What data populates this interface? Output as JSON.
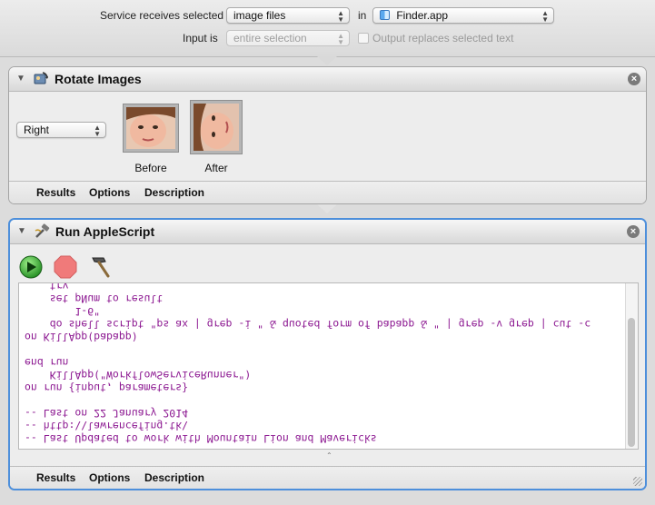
{
  "service": {
    "receives_label": "Service receives selected",
    "receives_value": "image files",
    "in_label": "in",
    "app_value": "Finder.app",
    "input_label": "Input is",
    "input_value": "entire selection",
    "output_label": "Output replaces selected text"
  },
  "rotate_action": {
    "title": "Rotate Images",
    "direction_value": "Right",
    "before_label": "Before",
    "after_label": "After",
    "tabs": [
      "Results",
      "Options",
      "Description"
    ]
  },
  "applescript_action": {
    "title": "Run AppleScript",
    "code_lines": [
      "-- Last Updated to work with Mountain Lion and Mavericks",
      "-- http:\\\\lawrencefing.tk\\",
      "-- Last on 22 January 2014",
      "",
      "on run {input, parameters}",
      "    KillApp(\"WorkflowServiceRunner\")",
      "end run",
      "",
      "on KillApp(babapp)",
      "    do shell script \"ps ax | grep -i \" & quoted form of babapp & \" | grep -v grep | cut -c",
      "        1-6\"",
      "    set pNum to result",
      "    try"
    ],
    "tabs": [
      "Results",
      "Options",
      "Description"
    ]
  },
  "colors": {
    "code_text": "#8d1a92",
    "selection_border": "#4d8fdb"
  }
}
